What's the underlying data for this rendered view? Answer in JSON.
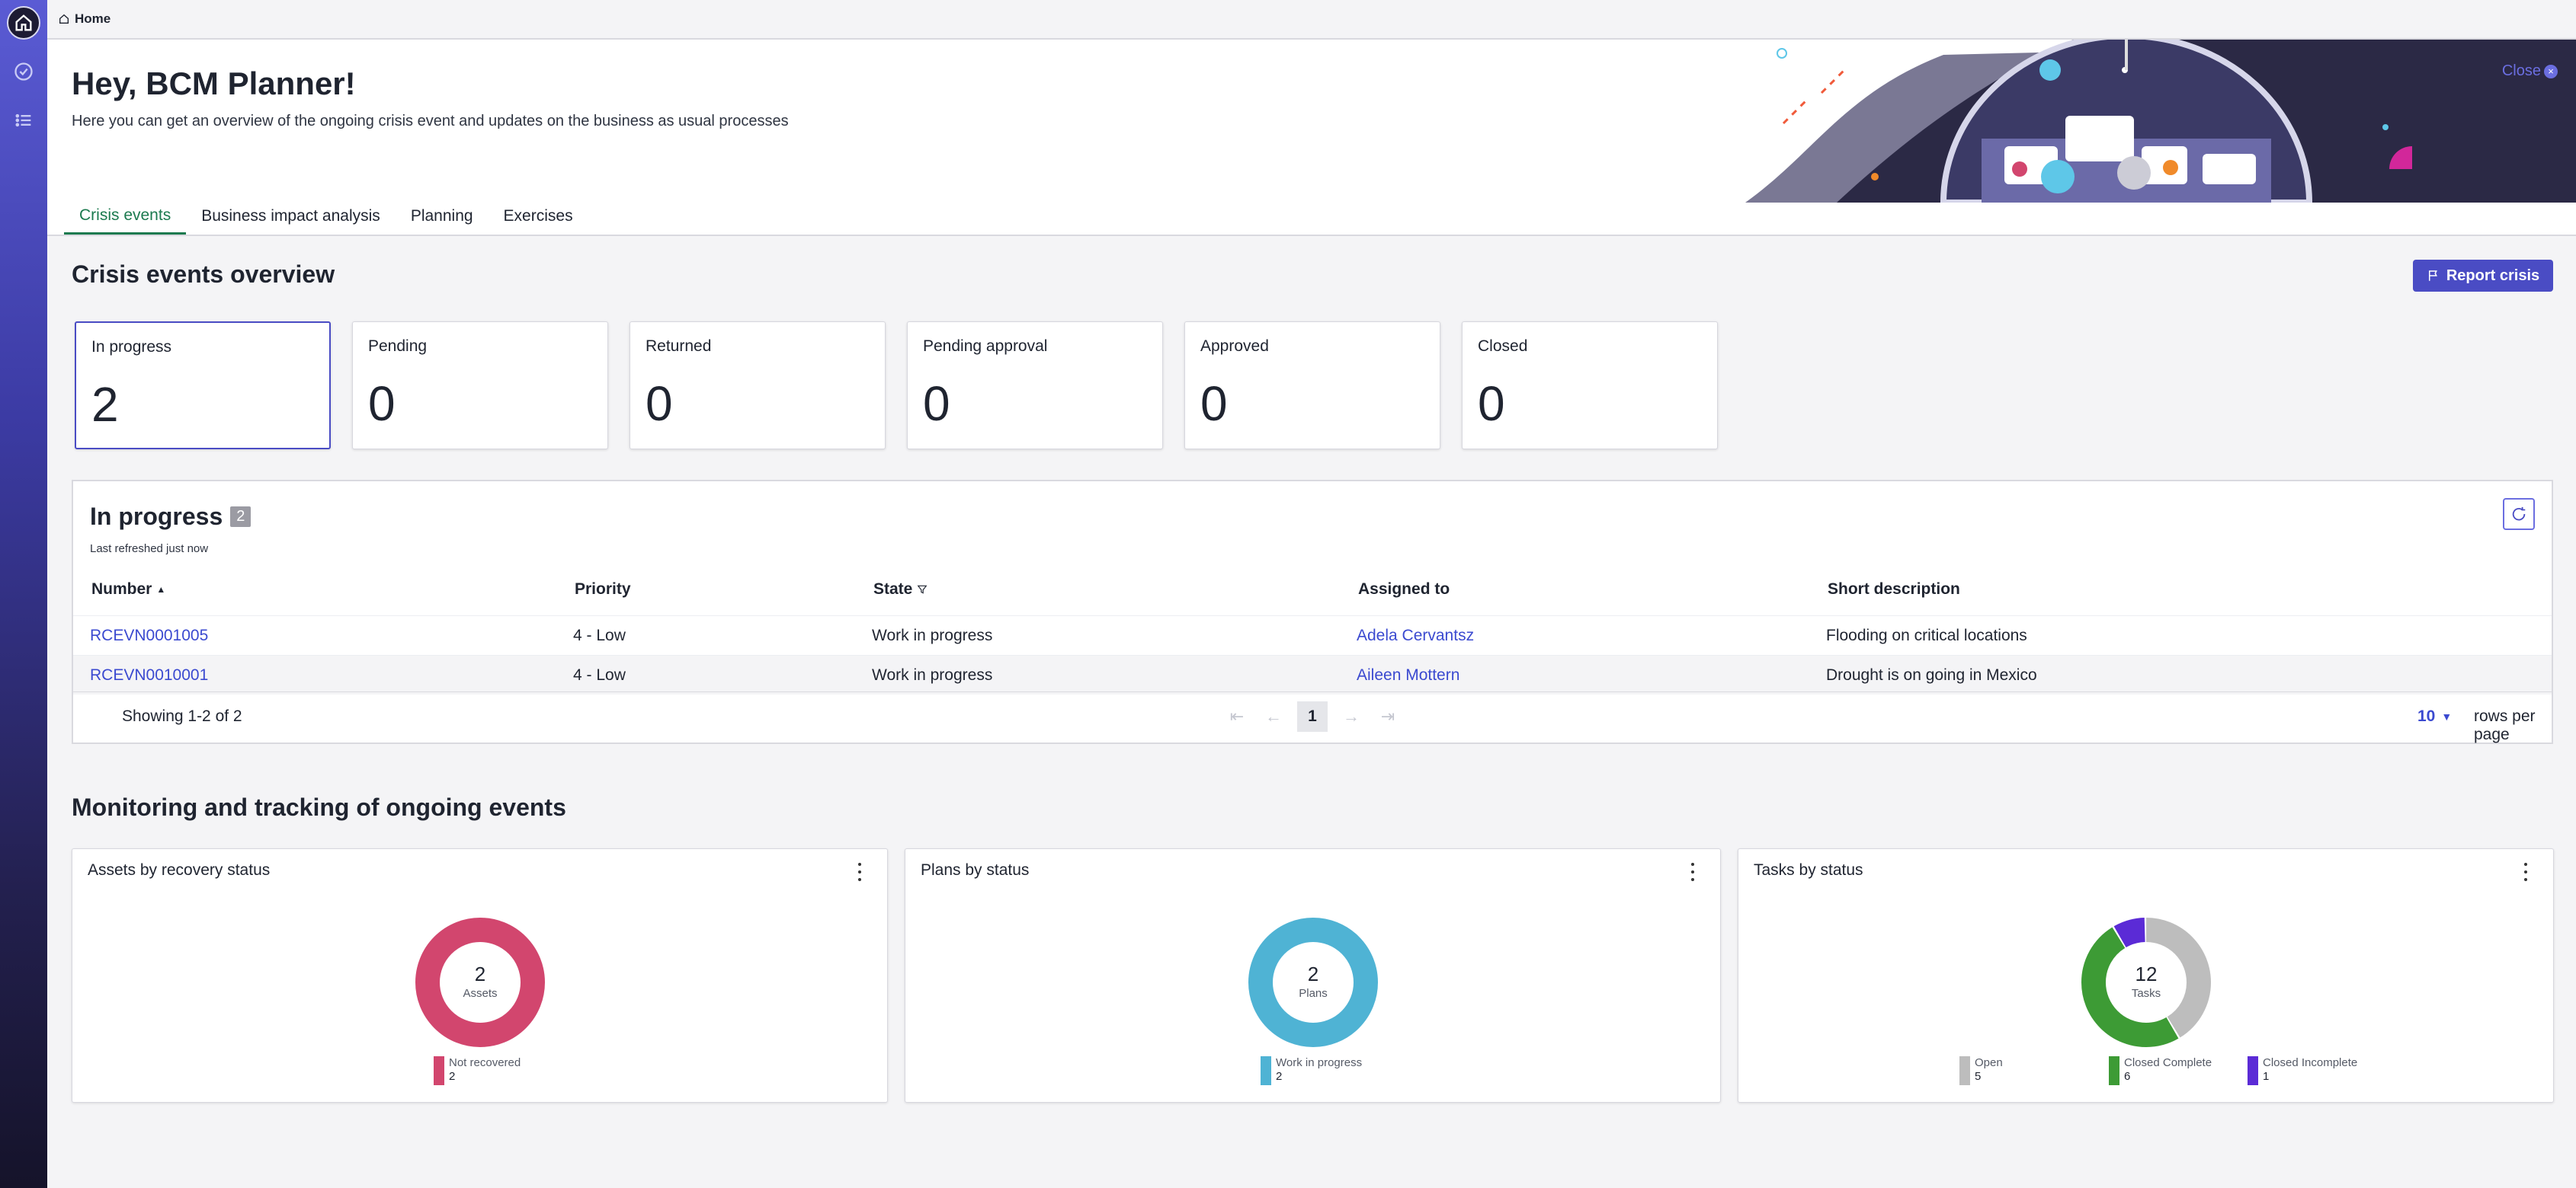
{
  "breadcrumb": {
    "label": "Home"
  },
  "header": {
    "greeting": "Hey, BCM Planner!",
    "subtitle": "Here you can get an overview of the ongoing crisis event and updates on the business as usual processes",
    "close_label": "Close"
  },
  "tabs": [
    {
      "label": "Crisis events",
      "active": true
    },
    {
      "label": "Business impact analysis",
      "active": false
    },
    {
      "label": "Planning",
      "active": false
    },
    {
      "label": "Exercises",
      "active": false
    }
  ],
  "overview": {
    "title": "Crisis events overview",
    "report_button": "Report crisis",
    "cards": [
      {
        "label": "In progress",
        "count": "2"
      },
      {
        "label": "Pending",
        "count": "0"
      },
      {
        "label": "Returned",
        "count": "0"
      },
      {
        "label": "Pending approval",
        "count": "0"
      },
      {
        "label": "Approved",
        "count": "0"
      },
      {
        "label": "Closed",
        "count": "0"
      }
    ]
  },
  "list": {
    "title": "In progress",
    "count": "2",
    "refreshed": "Last refreshed just now",
    "columns": [
      "Number",
      "Priority",
      "State",
      "Assigned to",
      "Short description"
    ],
    "rows": [
      {
        "number": "RCEVN0001005",
        "priority": "4 - Low",
        "state": "Work in progress",
        "assigned": "Adela Cervantsz",
        "desc": "Flooding on critical locations"
      },
      {
        "number": "RCEVN0010001",
        "priority": "4 - Low",
        "state": "Work in progress",
        "assigned": "Aileen Mottern",
        "desc": "Drought is on going in Mexico"
      }
    ],
    "showing": "Showing 1-2 of 2",
    "page": "1",
    "rows_per_page_value": "10",
    "rows_per_page_label": "rows per page"
  },
  "monitoring": {
    "title": "Monitoring and tracking of ongoing events",
    "widgets": [
      {
        "title": "Assets by recovery status",
        "total": "2",
        "unit": "Assets",
        "segments": [
          {
            "label": "Not recovered",
            "value": 2,
            "color": "#d2466e"
          }
        ]
      },
      {
        "title": "Plans by status",
        "total": "2",
        "unit": "Plans",
        "segments": [
          {
            "label": "Work in progress",
            "value": 2,
            "color": "#4fb3d4"
          }
        ]
      },
      {
        "title": "Tasks by status",
        "total": "12",
        "unit": "Tasks",
        "segments": [
          {
            "label": "Open",
            "value": 5,
            "color": "#bdbdbd"
          },
          {
            "label": "Closed Complete",
            "value": 6,
            "color": "#3d9b35"
          },
          {
            "label": "Closed Incomplete",
            "value": 1,
            "color": "#5b2bd6"
          }
        ]
      }
    ]
  },
  "colors": {
    "accent": "#4a4cc4",
    "tab_active": "#1c7a4f",
    "link": "#3b4ad0"
  },
  "icons": [
    "home-icon",
    "check-circle-icon",
    "list-icon",
    "flag-icon",
    "refresh-icon",
    "sort-asc-icon",
    "filter-icon",
    "more-vertical-icon"
  ]
}
